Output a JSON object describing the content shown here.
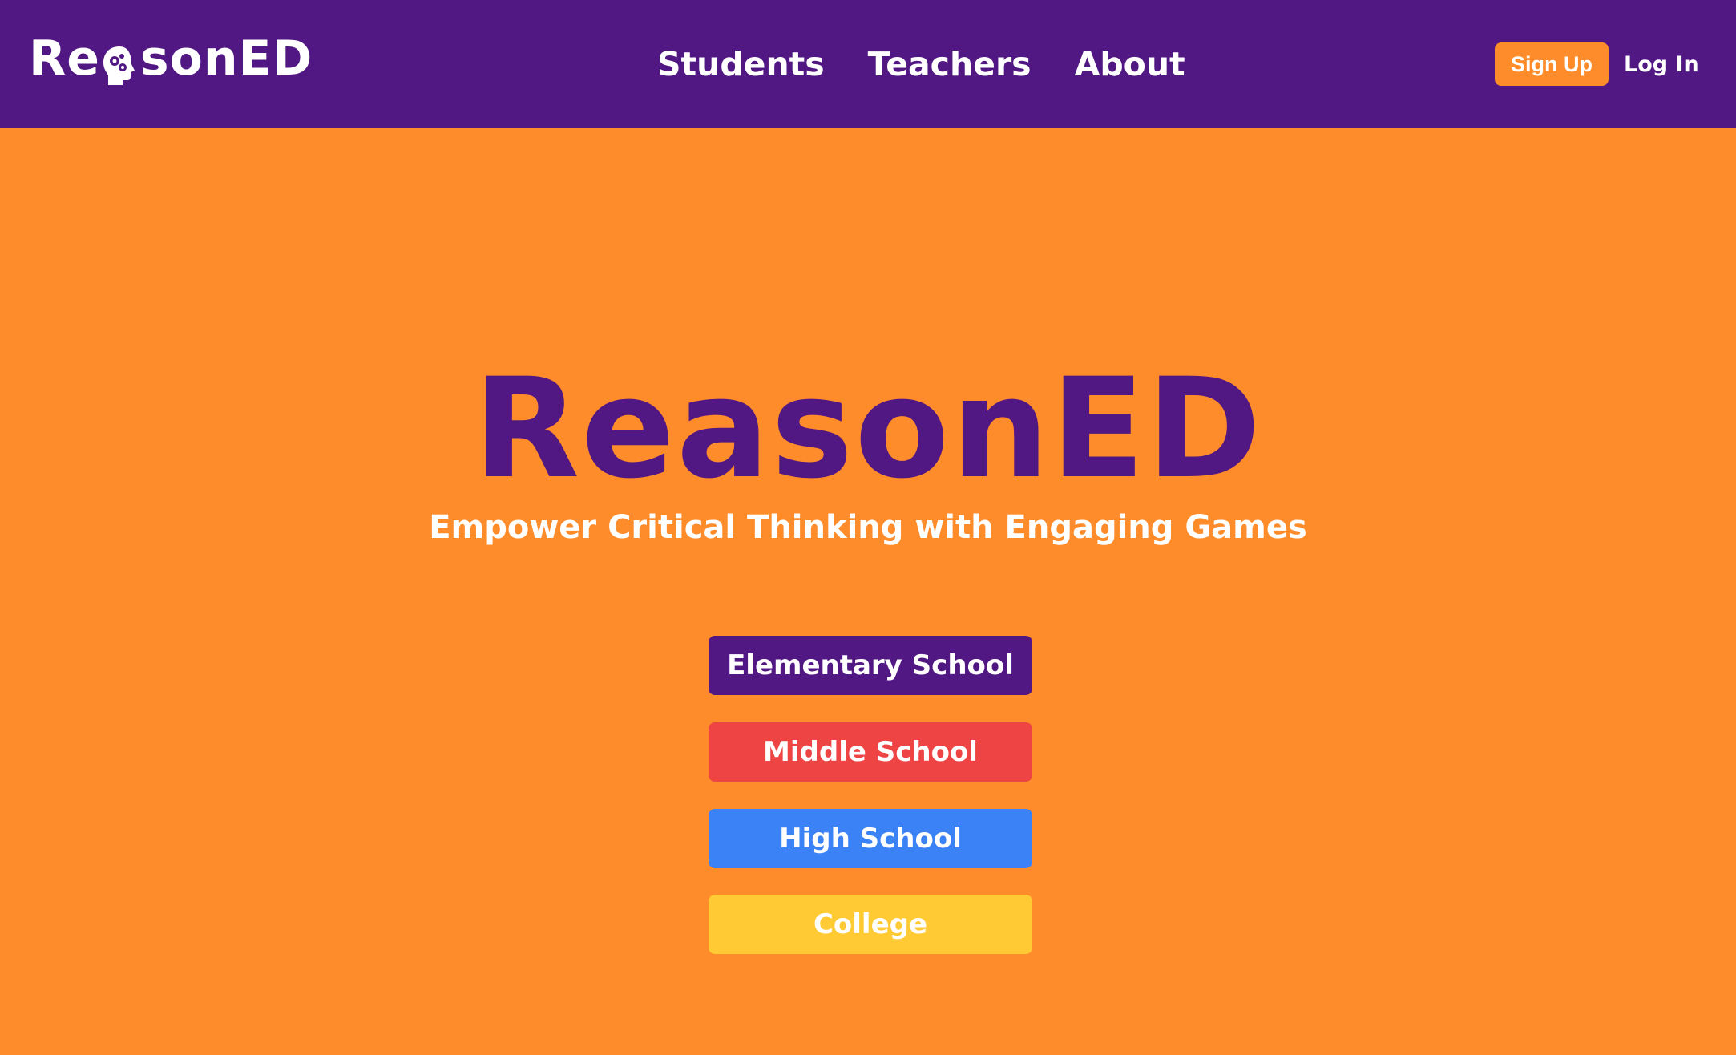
{
  "header": {
    "logo": {
      "text_before": "Re",
      "text_after": "sonED",
      "icon": "head-gears-icon"
    },
    "nav": [
      {
        "label": "Students"
      },
      {
        "label": "Teachers"
      },
      {
        "label": "About"
      }
    ],
    "signup_label": "Sign Up",
    "login_label": "Log In"
  },
  "hero": {
    "title": "ReasonED",
    "subtitle": "Empower Critical Thinking with Engaging Games",
    "levels": [
      {
        "label": "Elementary School",
        "color": "#511782"
      },
      {
        "label": "Middle School",
        "color": "#EF4444"
      },
      {
        "label": "High School",
        "color": "#3B82F6"
      },
      {
        "label": "College",
        "color": "#FFCA33"
      }
    ]
  },
  "colors": {
    "primary_purple": "#511782",
    "accent_orange": "#FF8C2B",
    "text_white": "#FFFFFF"
  }
}
